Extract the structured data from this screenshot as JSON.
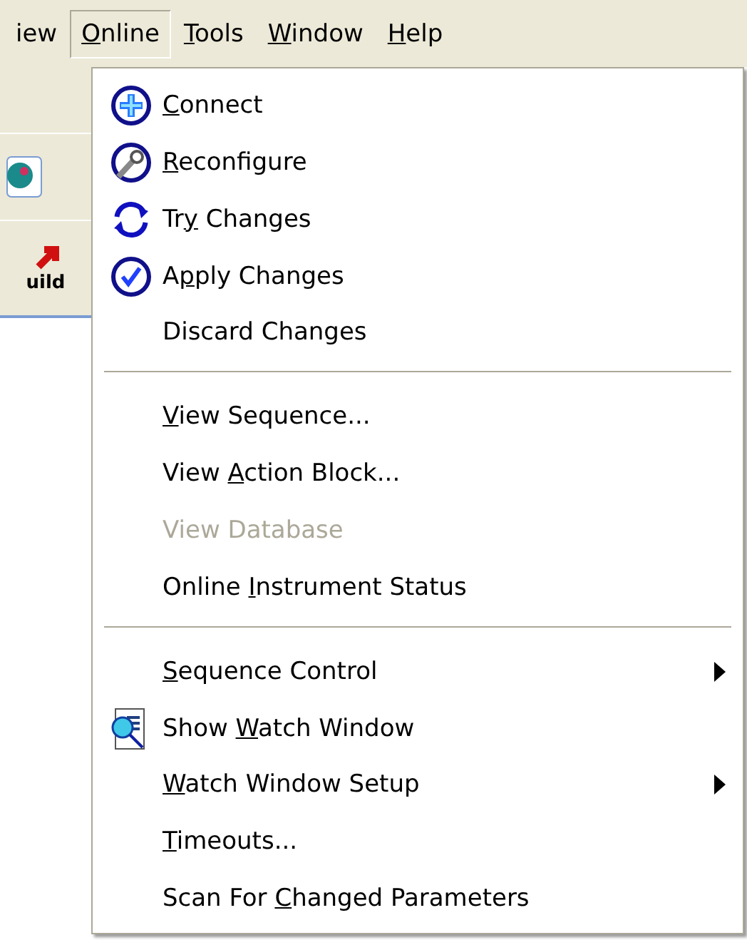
{
  "menu_bar": [
    {
      "post": "iew",
      "selected": false
    },
    {
      "key": "O",
      "post": "nline",
      "selected": true
    },
    {
      "key": "T",
      "post": "ools",
      "selected": false
    },
    {
      "key": "W",
      "post": "indow",
      "selected": false
    },
    {
      "key": "H",
      "post": "elp",
      "selected": false
    }
  ],
  "toolbar": {
    "build_label": "uild"
  },
  "menu": {
    "groups": [
      [
        {
          "key": "C",
          "post": "onnect",
          "kind": "connect",
          "disabled": false,
          "submenu": false
        },
        {
          "key": "R",
          "post": "econfigure",
          "kind": "reconfigure",
          "disabled": false,
          "submenu": false
        },
        {
          "pre": "Tr",
          "key": "y",
          "post": " Changes",
          "kind": "try",
          "disabled": false,
          "submenu": false
        },
        {
          "pre": "A",
          "key": "p",
          "post": "ply Changes",
          "kind": "apply",
          "disabled": false,
          "submenu": false
        },
        {
          "pre": "Discard Changes",
          "kind": "plain",
          "disabled": false,
          "submenu": false
        }
      ],
      [
        {
          "key": "V",
          "post": "iew Sequence...",
          "kind": "plain",
          "disabled": false,
          "submenu": false
        },
        {
          "pre": "View ",
          "key": "A",
          "post": "ction Block...",
          "kind": "plain",
          "disabled": false,
          "submenu": false
        },
        {
          "pre": "View Database",
          "kind": "plain",
          "disabled": true,
          "submenu": false
        },
        {
          "pre": "Online ",
          "key": "I",
          "post": "nstrument Status",
          "kind": "plain",
          "disabled": false,
          "submenu": false
        }
      ],
      [
        {
          "key": "S",
          "post": "equence Control",
          "kind": "plain",
          "disabled": false,
          "submenu": true
        },
        {
          "pre": "Show ",
          "key": "W",
          "post": "atch Window",
          "kind": "watch",
          "disabled": false,
          "submenu": false
        },
        {
          "key": "W",
          "post": "atch Window Setup",
          "kind": "plain",
          "disabled": false,
          "submenu": true
        },
        {
          "key": "T",
          "post": "imeouts...",
          "kind": "plain",
          "disabled": false,
          "submenu": false
        },
        {
          "pre": "Scan For ",
          "key": "C",
          "post": "hanged Parameters",
          "kind": "plain",
          "disabled": false,
          "submenu": false
        }
      ]
    ]
  }
}
